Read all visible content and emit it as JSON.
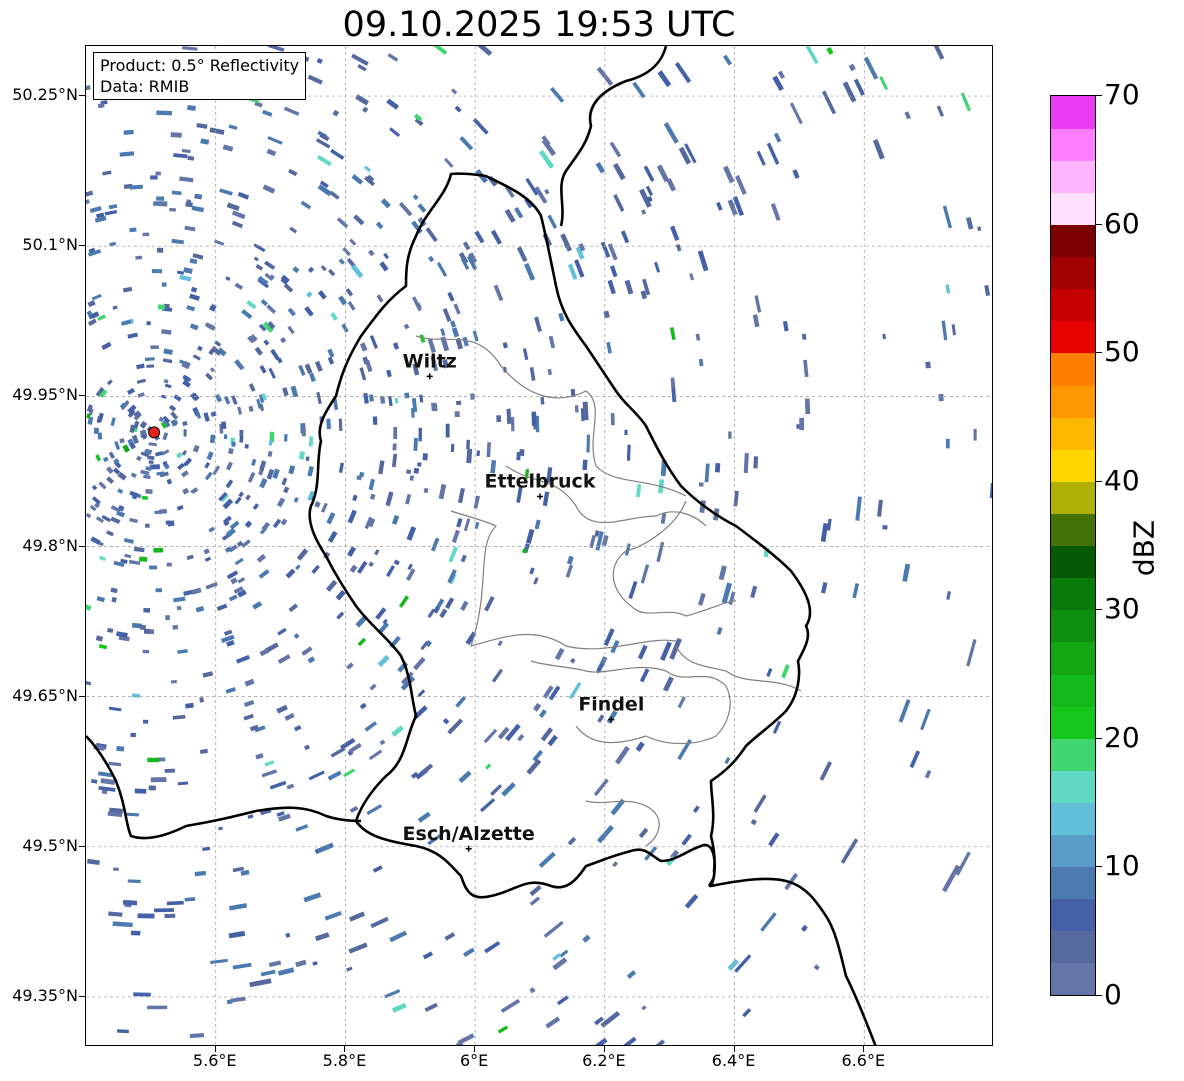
{
  "title": "09.10.2025 19:53 UTC",
  "info": {
    "product": "Product: 0.5° Reflectivity",
    "data": "Data: RMIB"
  },
  "map": {
    "lon_range": [
      5.4,
      6.8
    ],
    "lat_range": [
      49.3,
      50.3
    ],
    "x_ticks": [
      {
        "value": 5.6,
        "label": "5.6°E"
      },
      {
        "value": 5.8,
        "label": "5.8°E"
      },
      {
        "value": 6.0,
        "label": "6°E"
      },
      {
        "value": 6.2,
        "label": "6.2°E"
      },
      {
        "value": 6.4,
        "label": "6.4°E"
      },
      {
        "value": 6.6,
        "label": "6.6°E"
      }
    ],
    "y_ticks": [
      {
        "value": 50.25,
        "label": "50.25°N"
      },
      {
        "value": 50.1,
        "label": "50.1°N"
      },
      {
        "value": 49.95,
        "label": "49.95°N"
      },
      {
        "value": 49.8,
        "label": "49.8°N"
      },
      {
        "value": 49.65,
        "label": "49.65°N"
      },
      {
        "value": 49.5,
        "label": "49.5°N"
      },
      {
        "value": 49.35,
        "label": "49.35°N"
      }
    ],
    "radar_site": {
      "lon": 5.505,
      "lat": 49.914,
      "color": "#e8221b"
    },
    "cities": [
      {
        "name": "Wiltz",
        "lon": 5.93,
        "lat": 49.97
      },
      {
        "name": "Ettelbruck",
        "lon": 6.1,
        "lat": 49.85
      },
      {
        "name": "Findel",
        "lon": 6.21,
        "lat": 49.627
      },
      {
        "name": "Esch/Alzette",
        "lon": 5.99,
        "lat": 49.498
      }
    ],
    "border_color": "#000000",
    "canton_color": "#808080",
    "grid": "on"
  },
  "colorbar": {
    "label": "dBZ",
    "min": 0,
    "max": 70,
    "ticks": [
      "0",
      "10",
      "20",
      "30",
      "40",
      "50",
      "60",
      "70"
    ],
    "bins": [
      "#6476a8",
      "#55699f",
      "#4460a6",
      "#4b7ab0",
      "#5a9dc8",
      "#63c0db",
      "#5fd8c4",
      "#3fd56f",
      "#15c71d",
      "#13b81a",
      "#12a612",
      "#0f8f0f",
      "#0a7a0a",
      "#065a06",
      "#437307",
      "#aeb004",
      "#ffd700",
      "#ffb800",
      "#ff9800",
      "#ff7f00",
      "#e60000",
      "#c60000",
      "#a10000",
      "#7a0000",
      "#ffe0ff",
      "#ffb4ff",
      "#ff7dff",
      "#ea3cf0"
    ]
  }
}
